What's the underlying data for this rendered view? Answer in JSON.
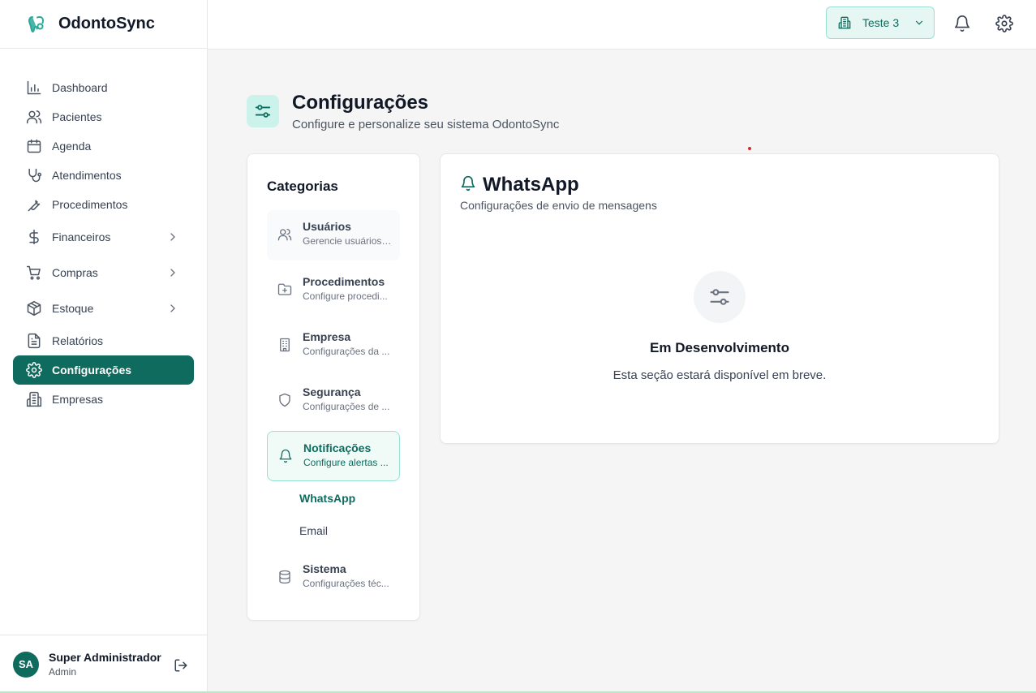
{
  "app": {
    "name": "OdontoSync"
  },
  "sidebar": {
    "items": [
      {
        "label": "Dashboard"
      },
      {
        "label": "Pacientes"
      },
      {
        "label": "Agenda"
      },
      {
        "label": "Atendimentos"
      },
      {
        "label": "Procedimentos"
      },
      {
        "label": "Financeiros"
      },
      {
        "label": "Compras"
      },
      {
        "label": "Estoque"
      },
      {
        "label": "Relatórios"
      },
      {
        "label": "Configurações"
      },
      {
        "label": "Empresas"
      }
    ],
    "active": "Configurações"
  },
  "user": {
    "initials": "SA",
    "name": "Super Administrador",
    "role": "Admin"
  },
  "topbar": {
    "company": "Teste 3"
  },
  "page": {
    "title": "Configurações",
    "subtitle": "Configure e personalize seu sistema OdontoSync"
  },
  "categories": {
    "title": "Categorias",
    "items": [
      {
        "label": "Usuários",
        "desc": "Gerencie usuários ..."
      },
      {
        "label": "Procedimentos",
        "desc": "Configure procedi..."
      },
      {
        "label": "Empresa",
        "desc": "Configurações da ..."
      },
      {
        "label": "Segurança",
        "desc": "Configurações de ..."
      },
      {
        "label": "Notificações",
        "desc": "Configure alertas ..."
      },
      {
        "label": "Sistema",
        "desc": "Configurações téc..."
      }
    ],
    "subitems": [
      {
        "label": "WhatsApp"
      },
      {
        "label": "Email"
      }
    ],
    "active": "Notificações",
    "active_sub": "WhatsApp"
  },
  "section": {
    "title": "WhatsApp",
    "subtitle": "Configurações de envio de mensagens",
    "empty_title": "Em Desenvolvimento",
    "empty_text": "Esta seção estará disponível em breve."
  },
  "colors": {
    "primary": "#0f6b5e",
    "accent_light": "#e6f7f3",
    "accent_border": "#99e0d4",
    "background": "#f5f5f5"
  }
}
